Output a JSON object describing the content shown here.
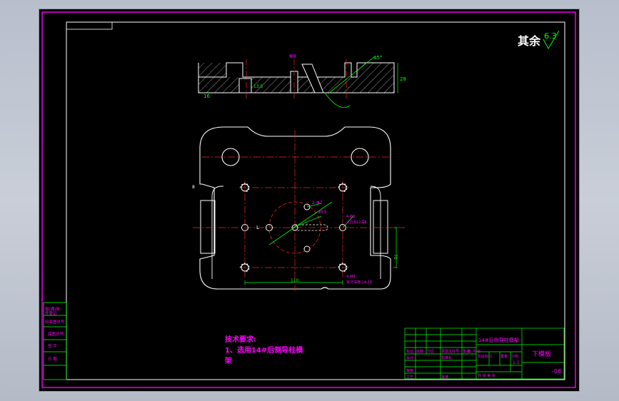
{
  "colors": {
    "background": "#000000",
    "border": "#ff00ff",
    "outline": "#ffffff",
    "center_line": "#ff2020",
    "dimension": "#00ff00",
    "annotation": "#ff00ff",
    "hidden": "#ffffff"
  },
  "roughness": {
    "prefix": "其余",
    "value": "6.3"
  },
  "tech_requirements": {
    "title": "技术要求:",
    "line1": "1、选用14#后侧导柱模",
    "line2": "架"
  },
  "title_block": {
    "assembly": "14#后侧导柱模架",
    "part_name": "下模板",
    "drawing_no": "-08",
    "scale": "1:1",
    "row_labels": [
      "标记",
      "处数",
      "分区",
      "更改文件号",
      "签名",
      "年 月 日"
    ],
    "designer": "设计",
    "standardization": "标准化",
    "reviewer": "审核",
    "process": "工艺",
    "approve": "批准",
    "stage_mark": "阶段标记",
    "weight": "重量",
    "ratio": "比例",
    "sheets": "共 张 第 张"
  },
  "side_box": {
    "r1": "借(通)用",
    "r2": "件登记",
    "r3": "旧底图总号",
    "r4": "底图总号",
    "r5": "签 字",
    "r6": "日 期"
  },
  "dims": {
    "front_label_top": "Φ8",
    "front_height": "28",
    "front_left": "16",
    "front_hole_depth": "13.5",
    "angle": "45°",
    "plan_width": "110",
    "plan_height": "70",
    "hole_note": "2-Φ7",
    "bore": "Φ55",
    "side_note": "4-Φ8",
    "side_note2": "沉孔Φ12深8",
    "bottom_note": "4-M8",
    "bottom_note2": "攻牙深度 14-16",
    "center_label": "L",
    "small_mark": "8"
  }
}
